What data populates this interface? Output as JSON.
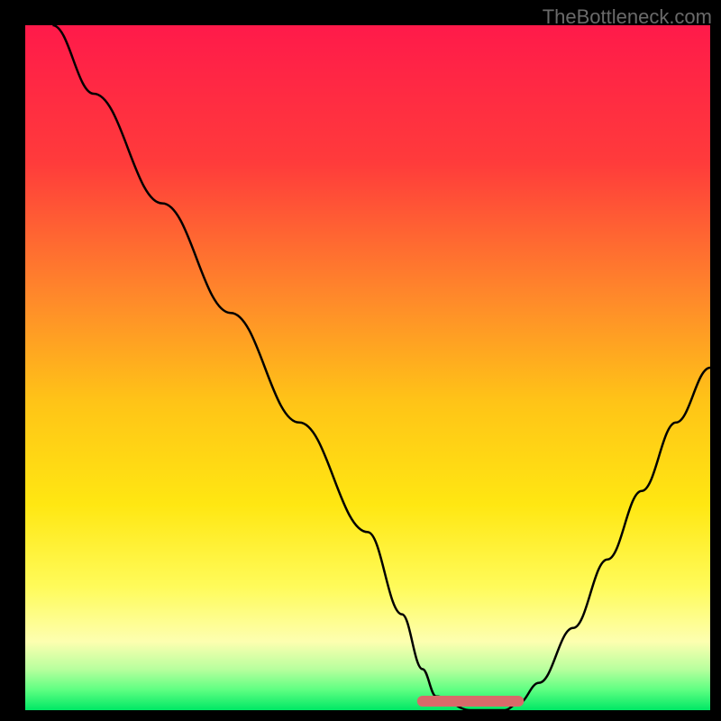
{
  "watermark": "TheBottleneck.com",
  "chart_data": {
    "type": "line",
    "title": "",
    "xlabel": "",
    "ylabel": "",
    "xlim": [
      0,
      100
    ],
    "ylim": [
      0,
      100
    ],
    "series": [
      {
        "name": "bottleneck-curve",
        "x": [
          4,
          10,
          20,
          30,
          40,
          50,
          55,
          58,
          60,
          65,
          70,
          72,
          75,
          80,
          85,
          90,
          95,
          100
        ],
        "y": [
          100,
          90,
          74,
          58,
          42,
          26,
          14,
          6,
          2,
          0,
          0,
          1,
          4,
          12,
          22,
          32,
          42,
          50
        ]
      },
      {
        "name": "optimal-band",
        "x": [
          58,
          72
        ],
        "y": [
          0,
          0
        ]
      }
    ],
    "gradient_stops": [
      {
        "pos": 0.0,
        "color": "#ff1a4a"
      },
      {
        "pos": 0.2,
        "color": "#ff3b3b"
      },
      {
        "pos": 0.4,
        "color": "#ff8a2a"
      },
      {
        "pos": 0.55,
        "color": "#ffc417"
      },
      {
        "pos": 0.7,
        "color": "#ffe712"
      },
      {
        "pos": 0.82,
        "color": "#fffb5a"
      },
      {
        "pos": 0.9,
        "color": "#fdffb0"
      },
      {
        "pos": 0.94,
        "color": "#b8ff9e"
      },
      {
        "pos": 0.97,
        "color": "#5fff82"
      },
      {
        "pos": 1.0,
        "color": "#00e865"
      }
    ],
    "optimal_marker_color": "#d86a6a"
  }
}
